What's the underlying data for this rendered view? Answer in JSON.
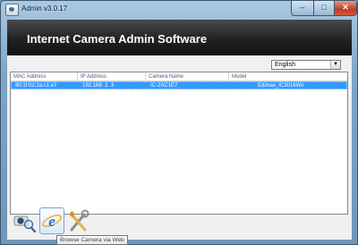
{
  "window": {
    "title": "Admin v3.0.17",
    "minimize_glyph": "–",
    "maximize_glyph": "□",
    "close_glyph": "✕"
  },
  "banner": {
    "title": "Internet Camera Admin Software"
  },
  "language": {
    "selected": "English",
    "arrow": "▼"
  },
  "camera_list": {
    "columns": [
      "MAC Address",
      "IP Address",
      "Camera Name",
      "Model"
    ],
    "rows": [
      {
        "mac": "80:1f:02:2a:c1:e7",
        "ip": "192.168.  2.  3",
        "name": "IC-2AC1E7",
        "model": "Edimax_IC3016Wn"
      }
    ]
  },
  "toolbar": {
    "items": [
      {
        "icon": "search-camera-icon"
      },
      {
        "icon": "browser-icon",
        "tooltip": "Browse Camera via Web"
      },
      {
        "icon": "tools-icon"
      }
    ]
  },
  "colors": {
    "selection": "#3399ff",
    "banner": "#222222",
    "frame": "#6f96b8"
  }
}
